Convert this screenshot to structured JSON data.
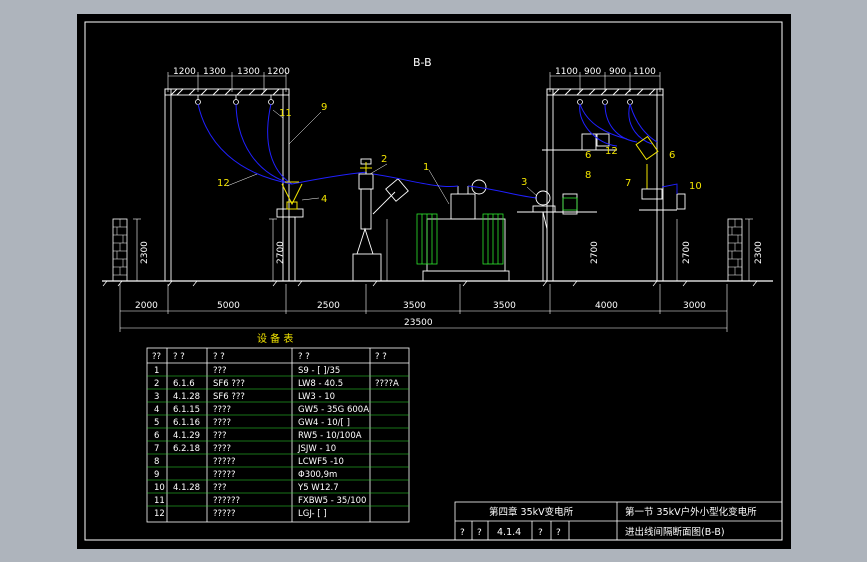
{
  "drawing": {
    "section_title": "B-B",
    "spacing_left": [
      "1200",
      "1300",
      "1300",
      "1200"
    ],
    "spacing_right": [
      "1100",
      "900",
      "900",
      "1100"
    ],
    "heights": {
      "wall_left": "2300",
      "frame_left": "2700",
      "frame_mid": "2700",
      "frame_right": "2700",
      "wall_right": "2300"
    },
    "dims": [
      "2000",
      "5000",
      "2500",
      "3500",
      "3500",
      "4000",
      "3000"
    ],
    "total": "23500",
    "callouts": [
      "1",
      "2",
      "3",
      "4",
      "6",
      "6",
      "7",
      "8",
      "9",
      "10",
      "11",
      "12",
      "12"
    ]
  },
  "table": {
    "title": "设 备 表",
    "headers": [
      "??",
      "? ?",
      "? ?",
      "? ?",
      "? ?"
    ],
    "rows": [
      [
        "1",
        "",
        "???",
        "S9 - [    ]/35",
        ""
      ],
      [
        "2",
        "6.1.6",
        "SF6 ???",
        "LW8 - 40.5",
        "????A"
      ],
      [
        "3",
        "4.1.28",
        "SF6 ???",
        "LW3 - 10",
        ""
      ],
      [
        "4",
        "6.1.15",
        "????",
        "GW5 - 35G   600A",
        ""
      ],
      [
        "5",
        "6.1.16",
        "????",
        "GW4 - 10/[  ]",
        ""
      ],
      [
        "6",
        "4.1.29",
        "???",
        "RW5 - 10/100A",
        ""
      ],
      [
        "7",
        "6.2.18",
        "????",
        "JSJW - 10",
        ""
      ],
      [
        "8",
        "",
        "?????",
        "LCWF5 -10",
        ""
      ],
      [
        "9",
        "",
        "?????",
        "Φ300,9m",
        ""
      ],
      [
        "10",
        "4.1.28",
        "???",
        "Y5 W12.7",
        ""
      ],
      [
        "11",
        "",
        "??????",
        "FXBW5 - 35/100",
        ""
      ],
      [
        "12",
        "",
        "?????",
        "LGJ- [    ]",
        ""
      ]
    ]
  },
  "title_block": {
    "chapter": "第四章  35kV变电所",
    "section": "第一节   35kV户外小型化变电所",
    "cell1": "?",
    "cell2": "?",
    "number": "4.1.4",
    "cell3": "?",
    "cell4": "?",
    "drawing_name": "进出线间隔断面图(B-B)"
  }
}
